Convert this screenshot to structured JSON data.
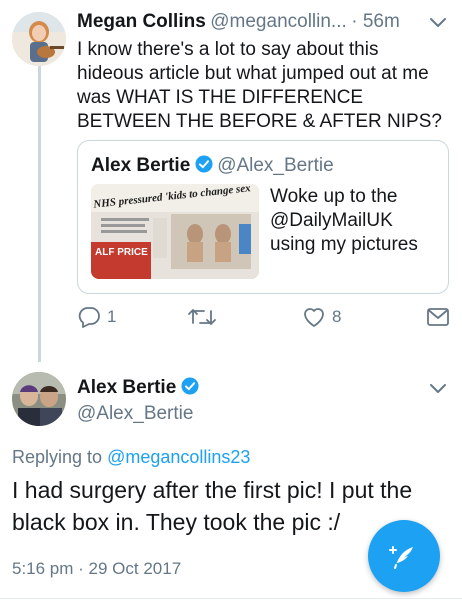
{
  "tweet1": {
    "author_name": "Megan Collins",
    "author_handle": "@megancollin...",
    "time": "· 56m",
    "text": "I know there's a lot to say about this hideous article but what jumped out at me was WHAT IS THE DIFFERENCE BETWEEN THE BEFORE & AFTER NIPS?",
    "reply_count": "1",
    "like_count": "8"
  },
  "quote": {
    "author_name": "Alex Bertie",
    "author_handle": "@Alex_Bertie",
    "text": "Woke up to the @DailyMailUK using my pictures",
    "thumb_headline": "NHS pressured 'kids to change sex",
    "thumb_banner": "ALF PRICE"
  },
  "tweet2": {
    "author_name": "Alex Bertie",
    "author_handle": "@Alex_Bertie",
    "replying_prefix": "Replying to",
    "replying_to": "@megancollins23",
    "text": "I had surgery after the first pic! I put the black box in. They took the pic :/",
    "timestamp": "5:16 pm · 29 Oct 2017"
  },
  "colors": {
    "accent": "#1da1f2",
    "muted": "#657786",
    "border": "#ccd6dd"
  },
  "icons": [
    "reply-icon",
    "retweet-icon",
    "like-icon",
    "dm-icon",
    "chevron-down-icon",
    "verified-badge-icon",
    "compose-tweet-icon"
  ]
}
